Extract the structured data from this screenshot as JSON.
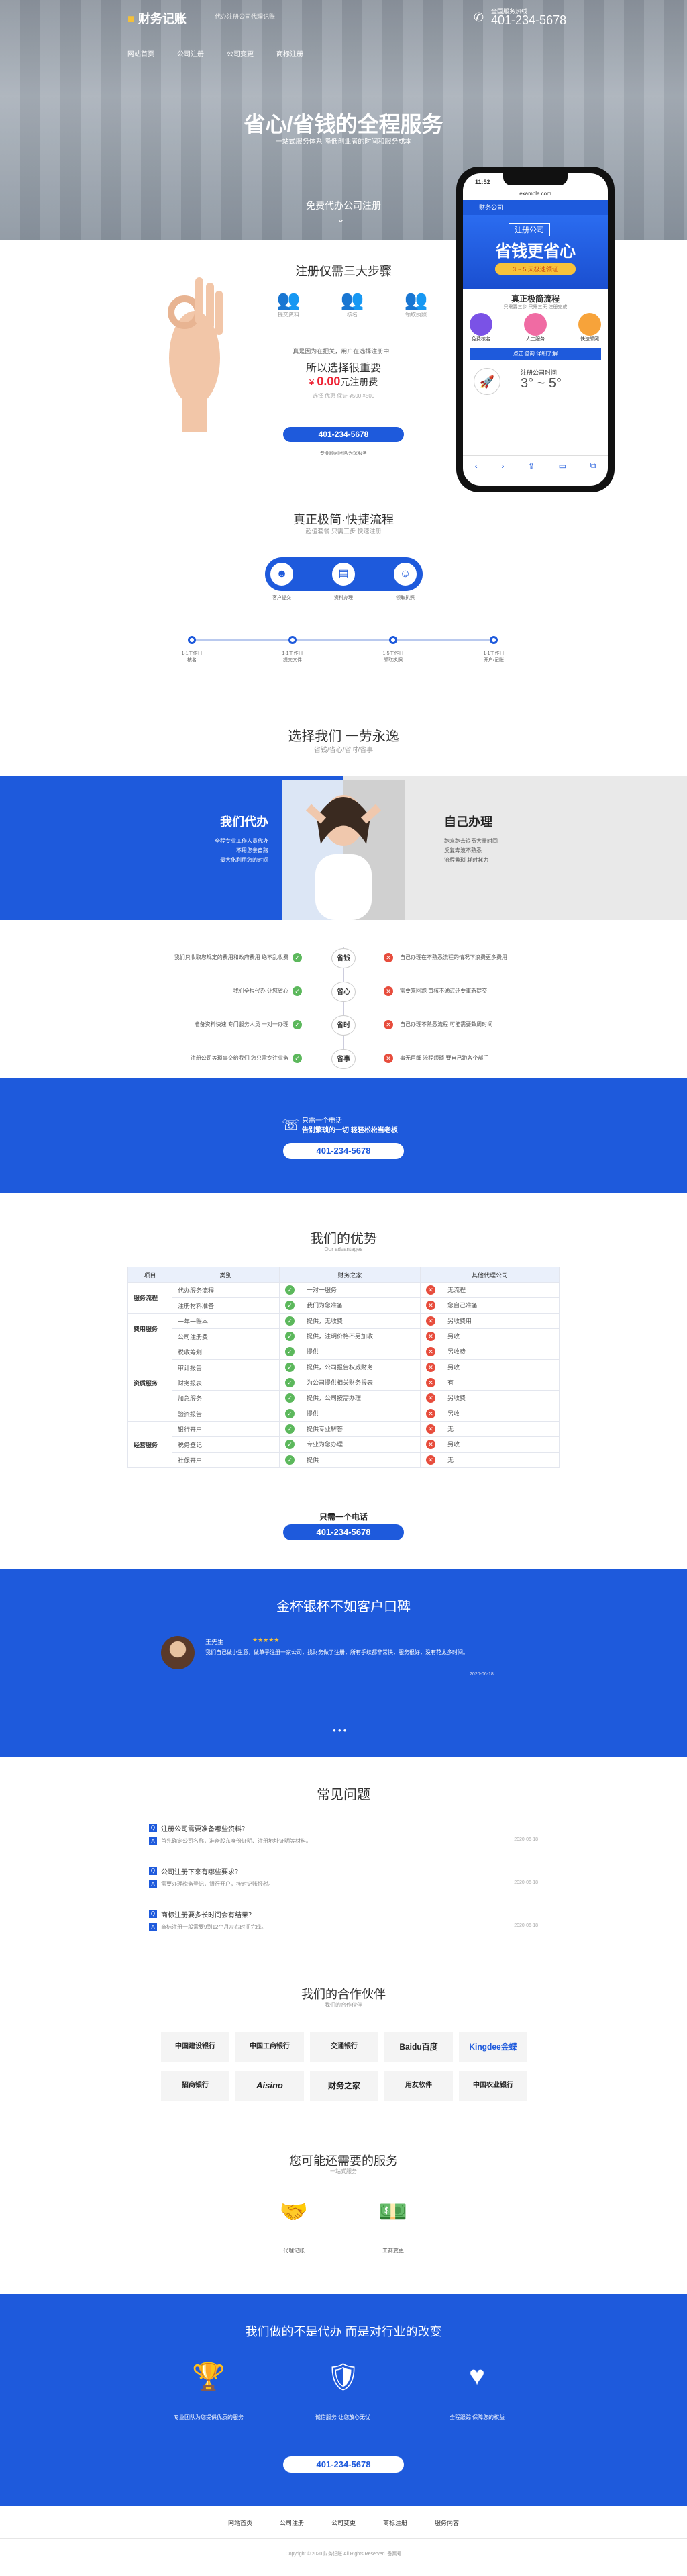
{
  "brand": {
    "name": "财务记账",
    "tagline": "代办注册公司代理记账",
    "phone_label": "全国服务热线",
    "phone": "401-234-5678"
  },
  "nav": [
    "网站首页",
    "公司注册",
    "公司变更",
    "商标注册"
  ],
  "hero": {
    "title": "省心/省钱的全程服务",
    "subtitle": "一站式服务体系 降低创业者的时间和服务成本",
    "cta": "免费代办公司注册"
  },
  "register": {
    "title": "注册仅需三大步骤",
    "steps": [
      "提交资料",
      "核名",
      "领取执照"
    ],
    "text": "真是因为在把关，用户在选择注册中...",
    "question": "所以选择很重要",
    "price_prefix": "¥",
    "price": "0.00",
    "price_suffix": "元注册费",
    "price_note": "选择 优惠 保证 ¥500 ¥500",
    "phone": "401-234-5678",
    "note": "专业顾问团队为您服务"
  },
  "phone_mock": {
    "time": "11:52",
    "url": "example.com",
    "app": "财务公司",
    "tag": "注册公司",
    "headline": "省钱更省心",
    "badge": "3 ~ 5 天极速领证",
    "flow_title": "真正极简流程",
    "flow_sub": "只需要三步 只需三天 注册完成",
    "icons": [
      "免费核名",
      "人工服务",
      "快速领照"
    ],
    "button": "点击咨询 详细了解",
    "reg_label": "注册公司时间",
    "reg_value": "3° ~ 5°"
  },
  "flow": {
    "title": "真正极简·快捷流程",
    "subtitle": "超值套餐 只需三步 快速注册",
    "circles": [
      "客户提交",
      "资料办理",
      "领取执照"
    ],
    "timeline": [
      "1-1工作日",
      "1-1工作日",
      "1-5工作日",
      "1-1工作日"
    ],
    "timeline_sub": [
      "核名",
      "提交文件",
      "领取执照",
      "开户/记账"
    ]
  },
  "choose": {
    "title": "选择我们 一劳永逸",
    "subtitle": "省钱/省心/省时/省事",
    "left_title": "我们代办",
    "left_lines": [
      "全程专业工作人员代办",
      "不用您亲自跑",
      "最大化利用您的时间"
    ],
    "right_title": "自己办理",
    "right_lines": [
      "跑来跑去浪费大量时间",
      "反复奔波不熟悉",
      "流程繁琐 耗时耗力"
    ]
  },
  "compare_rows": [
    {
      "left": "我们只收取您规定的费用和政府费用 绝不乱收费",
      "tag": "省钱",
      "right": "自己办理在不熟悉流程的情况下浪费更多费用"
    },
    {
      "left": "我们全程代办 让您省心",
      "tag": "省心",
      "right": "需要来回跑 审核不通过还要重新提交"
    },
    {
      "left": "准备资料快速 专门服务人员 一对一办理",
      "tag": "省时",
      "right": "自己办理不熟悉流程 可能需要数周时间"
    },
    {
      "left": "注册公司等琐事交给我们 您只需专注业务",
      "tag": "省事",
      "right": "事无巨细 流程烦琐 要自己跑各个部门"
    }
  ],
  "call": {
    "line1": "只需一个电话",
    "line2": "告别繁琐的一切 轻轻松松当老板",
    "phone": "401-234-5678"
  },
  "adv": {
    "title": "我们的优势",
    "subtitle": "Our advantages",
    "headers": [
      "项目",
      "类别",
      "财务之家",
      "其他代理公司"
    ],
    "groups": [
      {
        "name": "服务流程",
        "rows": [
          [
            "代办服务流程",
            "一对一服务",
            "无流程"
          ],
          [
            "注册材料准备",
            "我们为您准备",
            "您自己准备"
          ]
        ]
      },
      {
        "name": "费用服务",
        "rows": [
          [
            "一年一账本",
            "提供，无收费",
            "另收费用"
          ],
          [
            "公司注册费",
            "提供，注明价格不另加收",
            "另收"
          ]
        ]
      },
      {
        "name": "资质服务",
        "rows": [
          [
            "税收筹划",
            "提供",
            "另收费"
          ],
          [
            "审计报告",
            "提供，公司报告权威财务",
            "另收"
          ],
          [
            "财务报表",
            "为公司提供相关财务报表",
            "有"
          ],
          [
            "加急服务",
            "提供，公司按需办理",
            "另收费"
          ],
          [
            "验资报告",
            "提供",
            "另收"
          ]
        ]
      },
      {
        "name": "经营服务",
        "rows": [
          [
            "银行开户",
            "提供专业解答",
            "无"
          ],
          [
            "税务登记",
            "专业为您办理",
            "另收"
          ],
          [
            "社保开户",
            "提供",
            "无"
          ]
        ]
      }
    ],
    "cta_text": "只需一个电话",
    "phone": "401-234-5678"
  },
  "testimonial": {
    "title": "金杯银杯不如客户口碑",
    "name": "王先生",
    "text": "我们自己做小生意，做单子注册一家公司，找财务做了注册，所有手续都非常快，服务很好，没有花太多时间。",
    "date": "2020-06-18"
  },
  "faq": {
    "title": "常见问题",
    "items": [
      {
        "q": "注册公司需要准备哪些资料？",
        "a": "首先确定公司名称，准备股东身份证明、注册地址证明等材料。",
        "date": "2020-06-18"
      },
      {
        "q": "公司注册下来有哪些要求？",
        "a": "需要办理税务登记，银行开户，按时记账报税。",
        "date": "2020-06-18"
      },
      {
        "q": "商标注册要多长时间会有结果？",
        "a": "商标注册一般需要9到12个月左右时间完成。",
        "date": "2020-06-18"
      }
    ]
  },
  "partners": {
    "title": "我们的合作伙伴",
    "subtitle": "我们的合作伙伴",
    "logos": [
      "中国建设银行",
      "中国工商银行",
      "交通银行",
      "Baidu百度",
      "Kingdee金蝶",
      "招商银行",
      "Aisino",
      "财务之家",
      "用友软件",
      "中国农业银行"
    ]
  },
  "maybe": {
    "title": "您可能还需要的服务",
    "subtitle": "一站式服务",
    "items": [
      "代理记账",
      "工商变更"
    ]
  },
  "mission": {
    "title": "我们做的不是代办 而是对行业的改变",
    "items": [
      "专业团队为您提供优质的服务",
      "诚信服务 让您放心无忧",
      "全程跟踪 保障您的权益"
    ],
    "phone": "401-234-5678"
  },
  "footer": {
    "links": [
      "网站首页",
      "公司注册",
      "公司变更",
      "商标注册",
      "服务内容"
    ],
    "copyright": "Copyright © 2020 财务记账 All Rights Reserved. 备案号"
  }
}
